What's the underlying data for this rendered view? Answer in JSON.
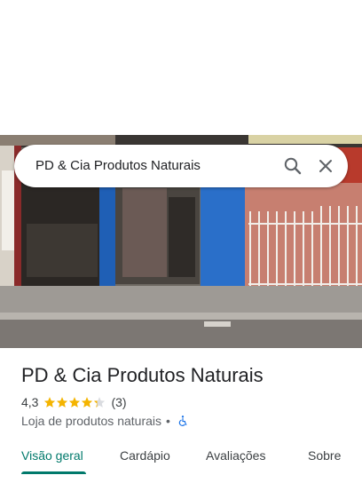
{
  "search": {
    "query": "PD & Cia Produtos Naturais",
    "search_icon": "search-icon",
    "close_icon": "close-icon"
  },
  "place": {
    "name": "PD & Cia Produtos Naturais",
    "rating": "4,3",
    "stars_value": 4.3,
    "stars_max": 5,
    "review_count": "(3)",
    "category": "Loja de produtos naturais",
    "separator": "•",
    "accessibility_icon": "wheelchair-icon"
  },
  "tabs": [
    {
      "label": "Visão geral",
      "active": true
    },
    {
      "label": "Cardápio",
      "active": false
    },
    {
      "label": "Avaliações",
      "active": false
    },
    {
      "label": "Sobre",
      "active": false
    }
  ],
  "colors": {
    "accent": "#00796b",
    "star": "#f4b400",
    "accessible": "#1a73e8"
  }
}
